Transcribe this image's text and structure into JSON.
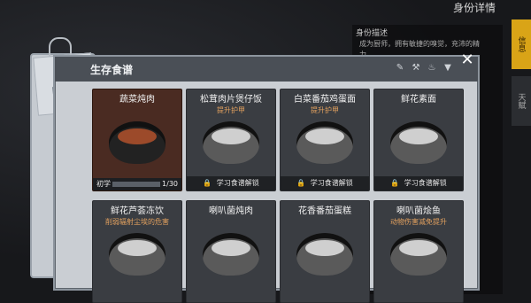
{
  "header": {
    "title": "身份详情"
  },
  "right_panel": {
    "desc_title": "身份描述",
    "desc_text": "成为厨师，拥有敏捷的嗅觉，充沛的精力……"
  },
  "side_tabs": [
    "信息",
    "天赋"
  ],
  "panel": {
    "title": "生存食谱"
  },
  "recipes_row1": [
    {
      "name": "蔬菜炖肉",
      "subtitle": "",
      "level_label": "初学",
      "level": "1/30",
      "locked": false
    },
    {
      "name": "松茸肉片煲仔饭",
      "subtitle": "提升护甲",
      "lock_text": "学习食谱解锁",
      "locked": true
    },
    {
      "name": "白菜番茄鸡蛋面",
      "subtitle": "提升护甲",
      "lock_text": "学习食谱解锁",
      "locked": true
    },
    {
      "name": "鲜花素面",
      "subtitle": "",
      "lock_text": "学习食谱解锁",
      "locked": true
    }
  ],
  "recipes_row2": [
    {
      "name": "鲜花芦荟冻饮",
      "subtitle": "削弱辐射尘埃的危害"
    },
    {
      "name": "喇叭菌炖肉",
      "subtitle": ""
    },
    {
      "name": "花香番茄蛋糕",
      "subtitle": ""
    },
    {
      "name": "喇叭菌烩鱼",
      "subtitle": "动物伤害减免提升"
    }
  ],
  "colors": {
    "accent": "#d9a417",
    "selected": "#4a2b22",
    "subtitle": "#e3a15f"
  },
  "icons": [
    "knife-icon",
    "pan-icon",
    "cup-icon",
    "filter-icon",
    "close-icon"
  ]
}
